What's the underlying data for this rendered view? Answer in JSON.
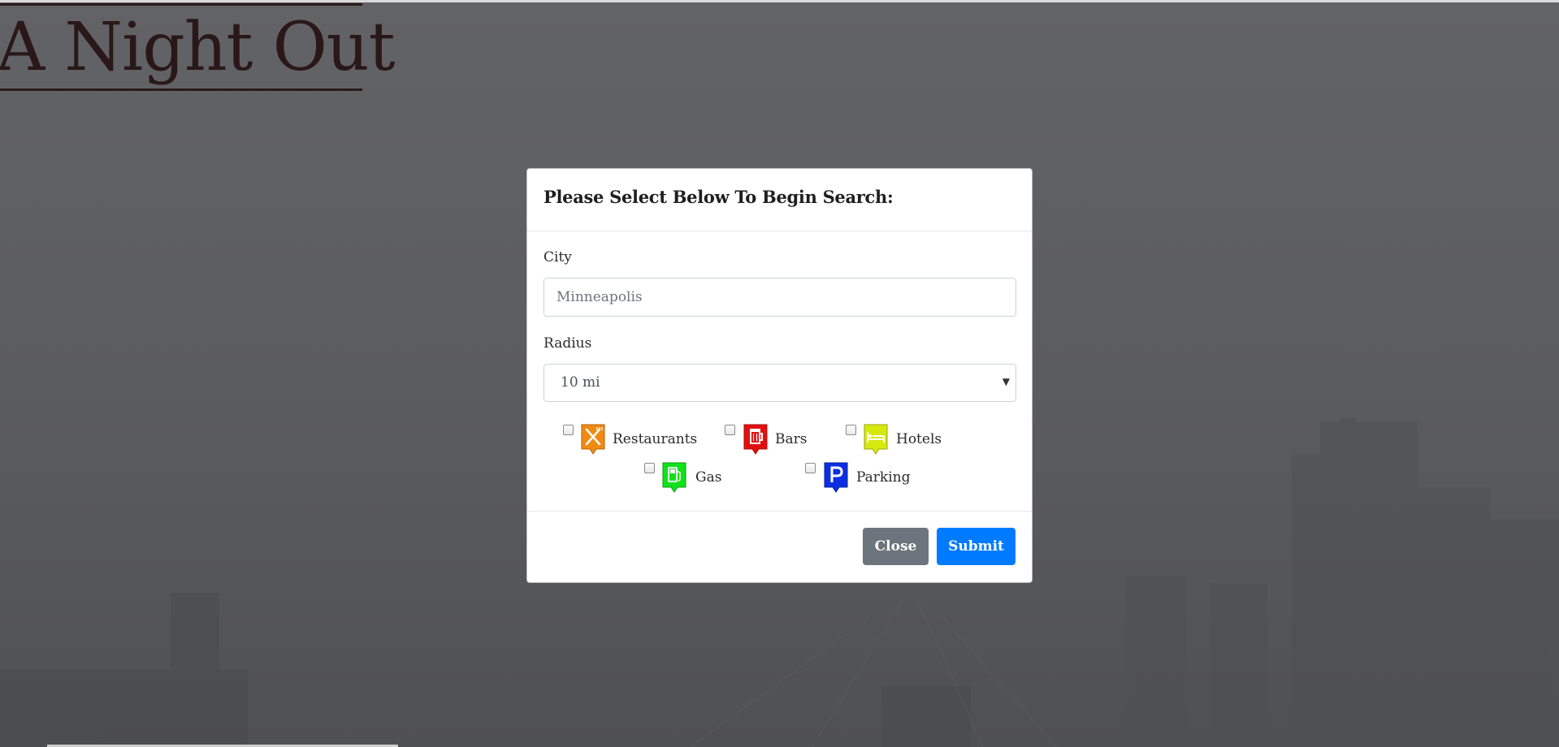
{
  "brand": {
    "title": "A Night Out"
  },
  "modal": {
    "title": "Please Select Below To Begin Search:",
    "city": {
      "label": "City",
      "placeholder": "Minneapolis",
      "value": ""
    },
    "radius": {
      "label": "Radius",
      "selected": "10 mi"
    },
    "categories": [
      {
        "label": "Restaurants",
        "icon": "restaurant-marker-icon",
        "color": "#f08a12",
        "checked": false
      },
      {
        "label": "Bars",
        "icon": "bar-marker-icon",
        "color": "#e30f0f",
        "checked": false
      },
      {
        "label": "Hotels",
        "icon": "hotel-marker-icon",
        "color": "#d6e80f",
        "checked": false
      },
      {
        "label": "Gas",
        "icon": "gas-marker-icon",
        "color": "#10e21a",
        "checked": false
      },
      {
        "label": "Parking",
        "icon": "parking-marker-icon",
        "color": "#0b2fe0",
        "checked": false
      }
    ],
    "buttons": {
      "close": "Close",
      "submit": "Submit"
    }
  },
  "colors": {
    "background": "#5e5f62",
    "primary": "#007bff",
    "secondary": "#6c757d",
    "brand_text": "#2a1818"
  }
}
